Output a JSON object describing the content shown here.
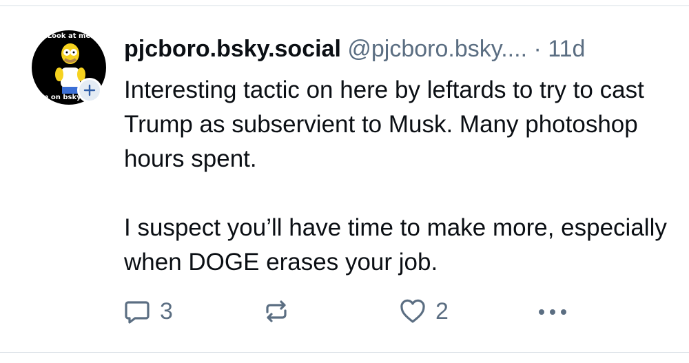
{
  "post": {
    "avatar": {
      "top_text": "Look at me",
      "bottom_text": "m on bsky."
    },
    "display_name": "pjcboro.bsky.social",
    "handle": "@pjcboro.bsky....",
    "separator": "·",
    "time": "11d",
    "paragraphs": [
      "Interesting tactic on here by leftards to try to cast Trump as subservient to Musk. Many photoshop hours spent.",
      "I suspect you’ll have time to make more, especially when DOGE erases your job."
    ],
    "actions": {
      "reply_count": "3",
      "like_count": "2"
    }
  },
  "colors": {
    "text": "#0b0f14",
    "muted": "#5b6e82",
    "badge_bg": "#e4ecf4",
    "divider": "#d6dde4"
  },
  "icons": [
    "plus-icon",
    "reply-icon",
    "repost-icon",
    "like-icon",
    "more-icon"
  ]
}
